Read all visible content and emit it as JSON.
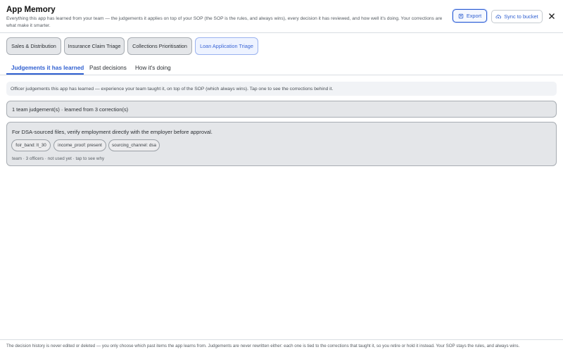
{
  "header": {
    "title": "App Memory",
    "subtitle": "Everything this app has learned from your team — the judgements it applies on top of your SOP (the SOP is the rules, and always wins), every decision it has reviewed, and how well it's doing. Your corrections are what make it smarter.",
    "export_label": "Export",
    "sync_label": "Sync to bucket",
    "close_icon": "close-icon"
  },
  "app_tabs": [
    {
      "label": "Sales & Distribution",
      "active": false
    },
    {
      "label": "Insurance Claim Triage",
      "active": false
    },
    {
      "label": "Collections Prioritisation",
      "active": false
    },
    {
      "label": "Loan Application Triage",
      "active": true
    }
  ],
  "sub_tabs": [
    {
      "label": "Judgements it has learned",
      "active": true
    },
    {
      "label": "Past decisions",
      "active": false
    },
    {
      "label": "How it's doing",
      "active": false
    }
  ],
  "info_text": "Officer judgements this app has learned — experience your team taught it, on top of the SOP (which always wins). Tap one to see the corrections behind it.",
  "summary_text": "1 team judgement(s) · learned from 3 correction(s)",
  "judgement": {
    "text": "For DSA-sourced files, verify employment directly with the employer before approval.",
    "chips": [
      "foir_band: lt_30",
      "income_proof: present",
      "sourcing_channel: dsa"
    ],
    "meta": "team · 3 officers · not used yet · tap to see why"
  },
  "footer_text": "The decision history is never edited or deleted — you only choose which past items the app learns from. Judgements are never rewritten either: each one is tied to the corrections that taught it, so you retire or hold it instead. Your SOP stays the rules, and always wins.",
  "colors": {
    "accent": "#2f5fd0",
    "card_bg": "#e4e6e9",
    "active_tab_bg": "#eef3ff"
  }
}
